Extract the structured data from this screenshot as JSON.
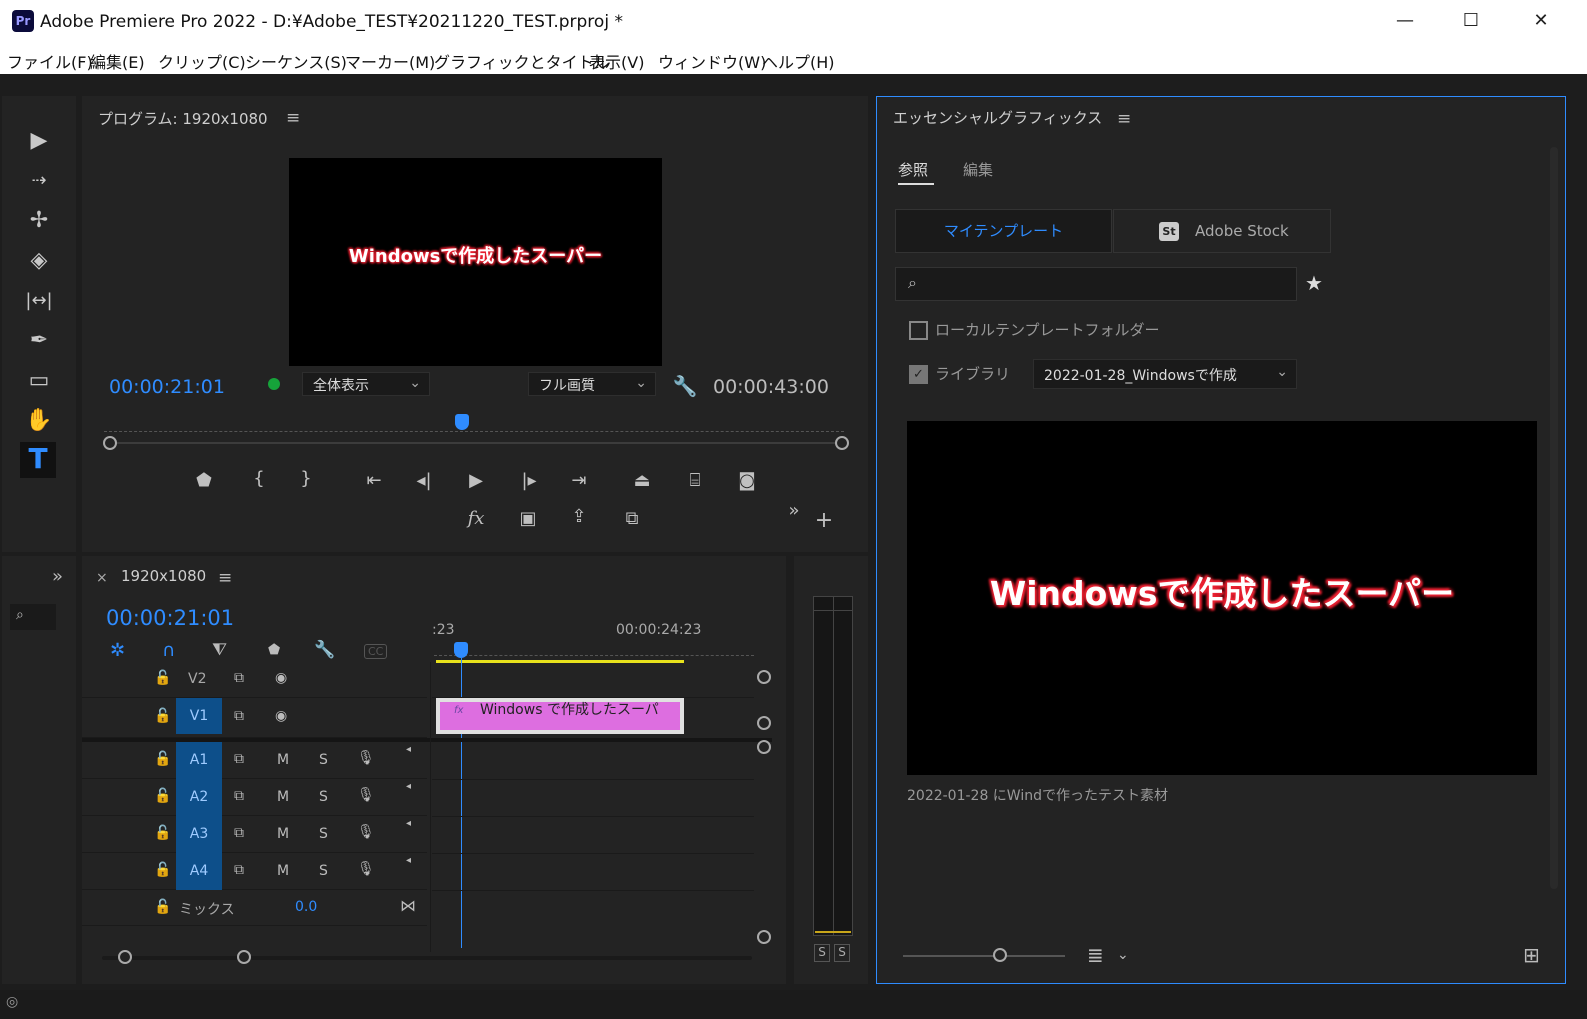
{
  "window": {
    "title": "Adobe Premiere Pro 2022 - D:¥Adobe_TEST¥20211220_TEST.prproj *",
    "app_icon": "Pr",
    "minimize": "—",
    "maximize": "☐",
    "close": "✕"
  },
  "menu": [
    "ファイル(F)",
    "編集(E)",
    "クリップ(C)",
    "シーケンス(S)",
    "マーカー(M)",
    "グラフィックとタイトル",
    "表示(V)",
    "ウィンドウ(W)",
    "ヘルプ(H)"
  ],
  "program": {
    "title": "プログラム: 1920x1080",
    "overlay_text": "Windowsで作成したスーパー",
    "timecode_current": "00:00:21:01",
    "timecode_duration": "00:00:43:00",
    "fit": "全体表示",
    "quality": "フル画質",
    "fx_label": "fx"
  },
  "timeline": {
    "close": "×",
    "title": "1920x1080",
    "timecode": "00:00:21:01",
    "ruler_left": ":23",
    "ruler_right": "00:00:24:23",
    "clip_label": "Windows で作成したスーパ",
    "clip_fx": "fx",
    "video_tracks": [
      "V2",
      "V1"
    ],
    "audio_tracks": [
      "A1",
      "A2",
      "A3",
      "A4"
    ],
    "mute": "M",
    "solo": "S",
    "mix_label": "ミックス",
    "mix_value": "0.0",
    "cc": "CC"
  },
  "meter": {
    "solo_left": "S",
    "solo_right": "S"
  },
  "essential": {
    "title": "エッセンシャルグラフィックス",
    "tab_browse": "参照",
    "tab_edit": "編集",
    "btn_my_templates": "マイテンプレート",
    "btn_adobe_stock": "Adobe Stock",
    "stock_icon": "St",
    "local_folder_label": "ローカルテンプレートフォルダー",
    "library_label": "ライブラリ",
    "library_value": "2022-01-28_Windowsで作成",
    "preview_text": "Windowsで作成したスーパー",
    "caption": "2022-01-28 にWindで作ったテスト素材"
  }
}
